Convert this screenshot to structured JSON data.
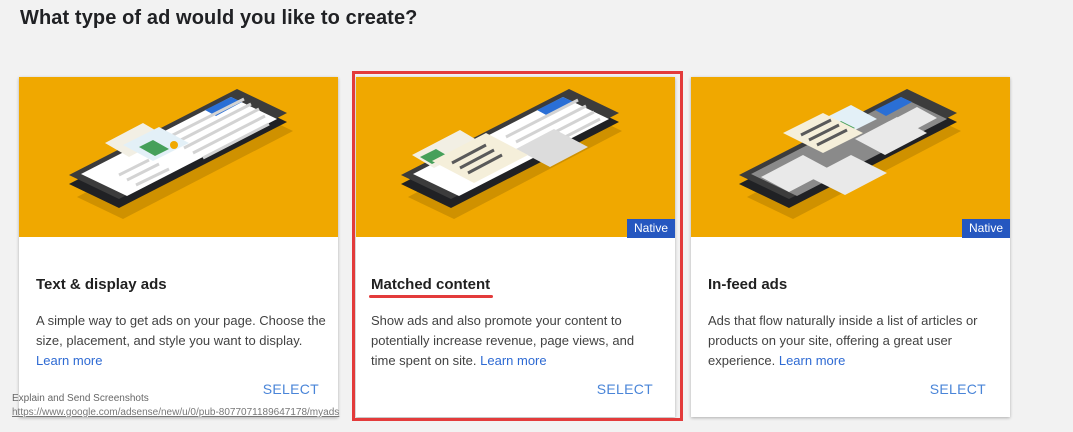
{
  "page": {
    "title": "What type of ad would you like to create?"
  },
  "cards": [
    {
      "title": "Text & display ads",
      "description": "A simple way to get ads on your page. Choose the size, placement, and style you want to display.",
      "learn_more": "Learn more",
      "select": "SELECT"
    },
    {
      "badge": "Native",
      "title": "Matched content",
      "description": "Show ads and also promote your content to potentially increase revenue, page views, and time spent on site.",
      "learn_more": "Learn more",
      "select": "SELECT"
    },
    {
      "badge": "Native",
      "title": "In-feed ads",
      "description": "Ads that flow naturally inside a list of articles or products on your site, offering a great user experience.",
      "learn_more": "Learn more",
      "select": "SELECT"
    }
  ],
  "overlay": {
    "caption": "Explain and Send Screenshots",
    "url": "https://www.google.com/adsense/new/u/0/pub-8077071189647178/myads"
  },
  "colors": {
    "card_art_bg": "#f0a800",
    "badge_bg": "#2557c0",
    "link": "#2e6ad3",
    "select": "#4a85d8",
    "annotation": "#e33b3b"
  }
}
